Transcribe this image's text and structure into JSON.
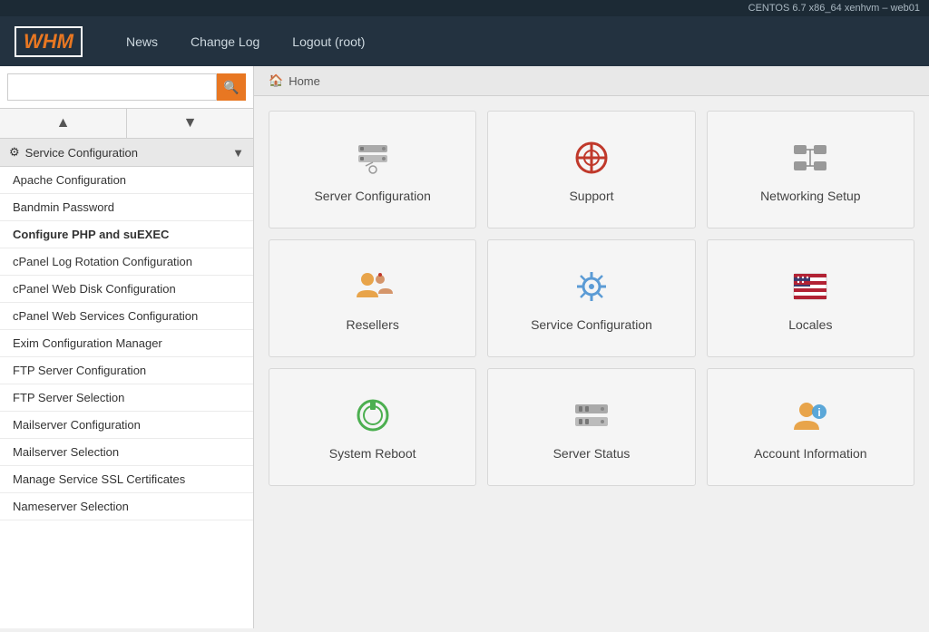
{
  "topbar": {
    "server_info": "CENTOS 6.7 x86_64 xenhvm – web01"
  },
  "header": {
    "logo": "WHM",
    "nav": [
      {
        "label": "News",
        "id": "news"
      },
      {
        "label": "Change Log",
        "id": "changelog"
      },
      {
        "label": "Logout (root)",
        "id": "logout"
      }
    ]
  },
  "search": {
    "placeholder": "",
    "button_icon": "🔍"
  },
  "sidebar": {
    "section_label": "Service Configuration",
    "items": [
      {
        "label": "Apache Configuration",
        "id": "apache-config",
        "active": false
      },
      {
        "label": "Bandmin Password",
        "id": "bandmin-password",
        "active": false
      },
      {
        "label": "Configure PHP and suEXEC",
        "id": "configure-php",
        "active": true
      },
      {
        "label": "cPanel Log Rotation Configuration",
        "id": "cpanel-log-rotation",
        "active": false
      },
      {
        "label": "cPanel Web Disk Configuration",
        "id": "cpanel-web-disk",
        "active": false
      },
      {
        "label": "cPanel Web Services Configuration",
        "id": "cpanel-web-services",
        "active": false
      },
      {
        "label": "Exim Configuration Manager",
        "id": "exim-config",
        "active": false
      },
      {
        "label": "FTP Server Configuration",
        "id": "ftp-server-config",
        "active": false
      },
      {
        "label": "FTP Server Selection",
        "id": "ftp-server-selection",
        "active": false
      },
      {
        "label": "Mailserver Configuration",
        "id": "mailserver-config",
        "active": false
      },
      {
        "label": "Mailserver Selection",
        "id": "mailserver-selection",
        "active": false
      },
      {
        "label": "Manage Service SSL Certificates",
        "id": "manage-ssl-certs",
        "active": false
      },
      {
        "label": "Nameserver Selection",
        "id": "nameserver-selection",
        "active": false
      }
    ]
  },
  "breadcrumb": {
    "home_label": "Home"
  },
  "grid": {
    "cards": [
      {
        "id": "server-configuration",
        "label": "Server Configuration",
        "icon": "server-config"
      },
      {
        "id": "support",
        "label": "Support",
        "icon": "support"
      },
      {
        "id": "networking-setup",
        "label": "Networking Setup",
        "icon": "networking"
      },
      {
        "id": "resellers",
        "label": "Resellers",
        "icon": "resellers"
      },
      {
        "id": "service-configuration",
        "label": "Service Configuration",
        "icon": "service-config"
      },
      {
        "id": "locales",
        "label": "Locales",
        "icon": "locales"
      },
      {
        "id": "system-reboot",
        "label": "System Reboot",
        "icon": "reboot"
      },
      {
        "id": "server-status",
        "label": "Server Status",
        "icon": "server-status"
      },
      {
        "id": "account-information",
        "label": "Account Information",
        "icon": "account-info"
      }
    ]
  }
}
